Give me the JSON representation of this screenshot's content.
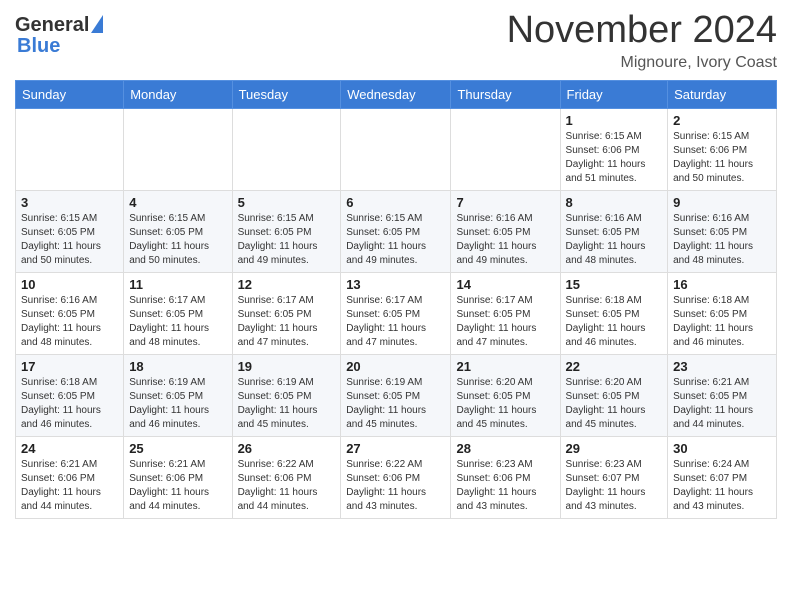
{
  "logo": {
    "general": "General",
    "blue": "Blue"
  },
  "title": "November 2024",
  "location": "Mignoure, Ivory Coast",
  "weekdays": [
    "Sunday",
    "Monday",
    "Tuesday",
    "Wednesday",
    "Thursday",
    "Friday",
    "Saturday"
  ],
  "rows": [
    [
      {
        "day": "",
        "info": ""
      },
      {
        "day": "",
        "info": ""
      },
      {
        "day": "",
        "info": ""
      },
      {
        "day": "",
        "info": ""
      },
      {
        "day": "",
        "info": ""
      },
      {
        "day": "1",
        "info": "Sunrise: 6:15 AM\nSunset: 6:06 PM\nDaylight: 11 hours\nand 51 minutes."
      },
      {
        "day": "2",
        "info": "Sunrise: 6:15 AM\nSunset: 6:06 PM\nDaylight: 11 hours\nand 50 minutes."
      }
    ],
    [
      {
        "day": "3",
        "info": "Sunrise: 6:15 AM\nSunset: 6:05 PM\nDaylight: 11 hours\nand 50 minutes."
      },
      {
        "day": "4",
        "info": "Sunrise: 6:15 AM\nSunset: 6:05 PM\nDaylight: 11 hours\nand 50 minutes."
      },
      {
        "day": "5",
        "info": "Sunrise: 6:15 AM\nSunset: 6:05 PM\nDaylight: 11 hours\nand 49 minutes."
      },
      {
        "day": "6",
        "info": "Sunrise: 6:15 AM\nSunset: 6:05 PM\nDaylight: 11 hours\nand 49 minutes."
      },
      {
        "day": "7",
        "info": "Sunrise: 6:16 AM\nSunset: 6:05 PM\nDaylight: 11 hours\nand 49 minutes."
      },
      {
        "day": "8",
        "info": "Sunrise: 6:16 AM\nSunset: 6:05 PM\nDaylight: 11 hours\nand 48 minutes."
      },
      {
        "day": "9",
        "info": "Sunrise: 6:16 AM\nSunset: 6:05 PM\nDaylight: 11 hours\nand 48 minutes."
      }
    ],
    [
      {
        "day": "10",
        "info": "Sunrise: 6:16 AM\nSunset: 6:05 PM\nDaylight: 11 hours\nand 48 minutes."
      },
      {
        "day": "11",
        "info": "Sunrise: 6:17 AM\nSunset: 6:05 PM\nDaylight: 11 hours\nand 48 minutes."
      },
      {
        "day": "12",
        "info": "Sunrise: 6:17 AM\nSunset: 6:05 PM\nDaylight: 11 hours\nand 47 minutes."
      },
      {
        "day": "13",
        "info": "Sunrise: 6:17 AM\nSunset: 6:05 PM\nDaylight: 11 hours\nand 47 minutes."
      },
      {
        "day": "14",
        "info": "Sunrise: 6:17 AM\nSunset: 6:05 PM\nDaylight: 11 hours\nand 47 minutes."
      },
      {
        "day": "15",
        "info": "Sunrise: 6:18 AM\nSunset: 6:05 PM\nDaylight: 11 hours\nand 46 minutes."
      },
      {
        "day": "16",
        "info": "Sunrise: 6:18 AM\nSunset: 6:05 PM\nDaylight: 11 hours\nand 46 minutes."
      }
    ],
    [
      {
        "day": "17",
        "info": "Sunrise: 6:18 AM\nSunset: 6:05 PM\nDaylight: 11 hours\nand 46 minutes."
      },
      {
        "day": "18",
        "info": "Sunrise: 6:19 AM\nSunset: 6:05 PM\nDaylight: 11 hours\nand 46 minutes."
      },
      {
        "day": "19",
        "info": "Sunrise: 6:19 AM\nSunset: 6:05 PM\nDaylight: 11 hours\nand 45 minutes."
      },
      {
        "day": "20",
        "info": "Sunrise: 6:19 AM\nSunset: 6:05 PM\nDaylight: 11 hours\nand 45 minutes."
      },
      {
        "day": "21",
        "info": "Sunrise: 6:20 AM\nSunset: 6:05 PM\nDaylight: 11 hours\nand 45 minutes."
      },
      {
        "day": "22",
        "info": "Sunrise: 6:20 AM\nSunset: 6:05 PM\nDaylight: 11 hours\nand 45 minutes."
      },
      {
        "day": "23",
        "info": "Sunrise: 6:21 AM\nSunset: 6:05 PM\nDaylight: 11 hours\nand 44 minutes."
      }
    ],
    [
      {
        "day": "24",
        "info": "Sunrise: 6:21 AM\nSunset: 6:06 PM\nDaylight: 11 hours\nand 44 minutes."
      },
      {
        "day": "25",
        "info": "Sunrise: 6:21 AM\nSunset: 6:06 PM\nDaylight: 11 hours\nand 44 minutes."
      },
      {
        "day": "26",
        "info": "Sunrise: 6:22 AM\nSunset: 6:06 PM\nDaylight: 11 hours\nand 44 minutes."
      },
      {
        "day": "27",
        "info": "Sunrise: 6:22 AM\nSunset: 6:06 PM\nDaylight: 11 hours\nand 43 minutes."
      },
      {
        "day": "28",
        "info": "Sunrise: 6:23 AM\nSunset: 6:06 PM\nDaylight: 11 hours\nand 43 minutes."
      },
      {
        "day": "29",
        "info": "Sunrise: 6:23 AM\nSunset: 6:07 PM\nDaylight: 11 hours\nand 43 minutes."
      },
      {
        "day": "30",
        "info": "Sunrise: 6:24 AM\nSunset: 6:07 PM\nDaylight: 11 hours\nand 43 minutes."
      }
    ]
  ]
}
